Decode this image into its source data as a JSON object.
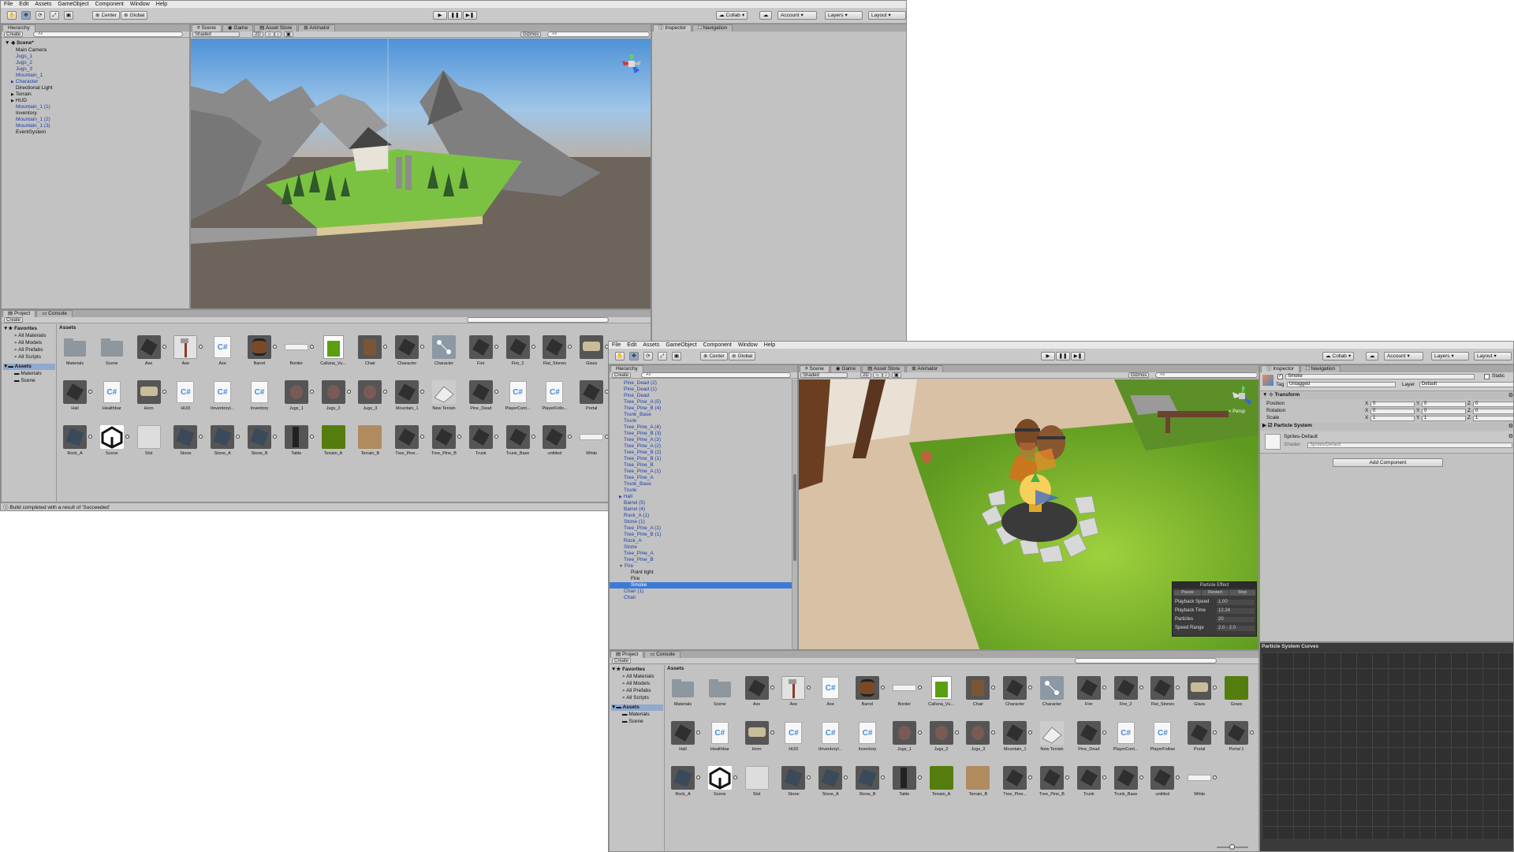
{
  "menu": [
    "File",
    "Edit",
    "Assets",
    "GameObject",
    "Component",
    "Window",
    "Help"
  ],
  "toolbar": {
    "center": "Center",
    "global": "Global",
    "collab": "Collab",
    "account": "Account",
    "layers": "Layers",
    "layout": "Layout"
  },
  "tabs": {
    "hierarchy": "Hierarchy",
    "scene": "Scene",
    "game": "Game",
    "asset_store": "Asset Store",
    "animator": "Animator",
    "inspector": "Inspector",
    "navigation": "Navigation",
    "project": "Project",
    "console": "Console"
  },
  "scene_bar": {
    "shaded": "Shaded",
    "two_d": "2D",
    "gizmos": "Gizmos",
    "all": "All"
  },
  "create": "Create",
  "w1": {
    "scene_name": "Scene*",
    "hierarchy": [
      {
        "label": "Main Camera",
        "depth": 1,
        "prefab": false,
        "arrow": ""
      },
      {
        "label": "Jugs_1",
        "depth": 1,
        "prefab": true,
        "arrow": ""
      },
      {
        "label": "Jugs_2",
        "depth": 1,
        "prefab": true,
        "arrow": ""
      },
      {
        "label": "Jugs_3",
        "depth": 1,
        "prefab": true,
        "arrow": ""
      },
      {
        "label": "Mountain_1",
        "depth": 1,
        "prefab": true,
        "arrow": ""
      },
      {
        "label": "Character",
        "depth": 1,
        "prefab": true,
        "arrow": "▶"
      },
      {
        "label": "Directional Light",
        "depth": 1,
        "prefab": false,
        "arrow": ""
      },
      {
        "label": "Terrain",
        "depth": 1,
        "prefab": false,
        "arrow": "▶"
      },
      {
        "label": "HUD",
        "depth": 1,
        "prefab": false,
        "arrow": "▶"
      },
      {
        "label": "Mountain_1 (1)",
        "depth": 1,
        "prefab": true,
        "arrow": ""
      },
      {
        "label": "Inventory",
        "depth": 1,
        "prefab": false,
        "arrow": ""
      },
      {
        "label": "Mountain_1 (2)",
        "depth": 1,
        "prefab": true,
        "arrow": ""
      },
      {
        "label": "Mountain_1 (3)",
        "depth": 1,
        "prefab": true,
        "arrow": ""
      },
      {
        "label": "EventSystem",
        "depth": 1,
        "prefab": false,
        "arrow": ""
      }
    ],
    "status": "Build completed with a result of 'Succeeded'"
  },
  "project": {
    "favorites": "Favorites",
    "fav_items": [
      "All Materials",
      "All Models",
      "All Prefabs",
      "All Scripts"
    ],
    "assets_folder": "Assets",
    "sub_folders": [
      "Materials",
      "Scene"
    ],
    "assets_header": "Assets"
  },
  "assets_w1": [
    {
      "label": "Materials",
      "icon": "folder"
    },
    {
      "label": "Scene",
      "icon": "folder"
    },
    {
      "label": "Axe",
      "icon": "dark"
    },
    {
      "label": "Axe",
      "icon": "axe"
    },
    {
      "label": "Axe",
      "icon": "script"
    },
    {
      "label": "Barrel",
      "icon": "barrel"
    },
    {
      "label": "Border",
      "icon": "bar"
    },
    {
      "label": "Calluna_Vu...",
      "icon": "green"
    },
    {
      "label": "Chair",
      "icon": "brown"
    },
    {
      "label": "Character",
      "icon": "dark"
    },
    {
      "label": "Character",
      "icon": "anim"
    },
    {
      "label": "Fire",
      "icon": "dark"
    },
    {
      "label": "Fire_2",
      "icon": "dark"
    },
    {
      "label": "Flat_Stones",
      "icon": "dark"
    },
    {
      "label": "Glass",
      "icon": "beige"
    },
    {
      "label": "Hall",
      "icon": "dark"
    },
    {
      "label": "Healthbar",
      "icon": "script"
    },
    {
      "label": "Horn",
      "icon": "beige"
    },
    {
      "label": "HUD",
      "icon": "script"
    },
    {
      "label": "IInventoryI...",
      "icon": "script"
    },
    {
      "label": "Inventory",
      "icon": "script"
    },
    {
      "label": "Jugs_1",
      "icon": "jug"
    },
    {
      "label": "Jugs_2",
      "icon": "jug"
    },
    {
      "label": "Jugs_3",
      "icon": "jug"
    },
    {
      "label": "Mountain_1",
      "icon": "dark"
    },
    {
      "label": "New Terrain",
      "icon": "terrain"
    },
    {
      "label": "Pine_Dead",
      "icon": "dark"
    },
    {
      "label": "PlayerCont...",
      "icon": "script"
    },
    {
      "label": "PlayerFollo...",
      "icon": "script"
    },
    {
      "label": "Portal",
      "icon": "dark"
    },
    {
      "label": "Rock_A",
      "icon": "rock"
    },
    {
      "label": "Scene",
      "icon": "unity"
    },
    {
      "label": "Slot",
      "icon": "white"
    },
    {
      "label": "Stone",
      "icon": "rock"
    },
    {
      "label": "Stone_A",
      "icon": "rock"
    },
    {
      "label": "Stone_B",
      "icon": "rock"
    },
    {
      "label": "Table",
      "icon": "table"
    },
    {
      "label": "Terrain_A",
      "icon": "moss"
    },
    {
      "label": "Terrain_B",
      "icon": "tan"
    },
    {
      "label": "Tree_Pine...",
      "icon": "dark"
    },
    {
      "label": "Tree_Pine_B",
      "icon": "dark"
    },
    {
      "label": "Trunk",
      "icon": "dark"
    },
    {
      "label": "Trunk_Base",
      "icon": "dark"
    },
    {
      "label": "untitled",
      "icon": "dark"
    },
    {
      "label": "White",
      "icon": "bar"
    }
  ],
  "w2": {
    "hierarchy": [
      {
        "label": "Pine_Dead (2)",
        "depth": 1,
        "prefab": true,
        "arrow": ""
      },
      {
        "label": "Pine_Dead (1)",
        "depth": 1,
        "prefab": true,
        "arrow": ""
      },
      {
        "label": "Pine_Dead",
        "depth": 1,
        "prefab": true,
        "arrow": ""
      },
      {
        "label": "Tree_Pine_A (5)",
        "depth": 1,
        "prefab": true,
        "arrow": ""
      },
      {
        "label": "Tree_Pine_B (4)",
        "depth": 1,
        "prefab": true,
        "arrow": ""
      },
      {
        "label": "Trunk_Base",
        "depth": 1,
        "prefab": true,
        "arrow": ""
      },
      {
        "label": "Trunk",
        "depth": 1,
        "prefab": true,
        "arrow": ""
      },
      {
        "label": "Tree_Pine_A (4)",
        "depth": 1,
        "prefab": true,
        "arrow": ""
      },
      {
        "label": "Tree_Pine_B (3)",
        "depth": 1,
        "prefab": true,
        "arrow": ""
      },
      {
        "label": "Tree_Pine_A (3)",
        "depth": 1,
        "prefab": true,
        "arrow": ""
      },
      {
        "label": "Tree_Pine_A (2)",
        "depth": 1,
        "prefab": true,
        "arrow": ""
      },
      {
        "label": "Tree_Pine_B (2)",
        "depth": 1,
        "prefab": true,
        "arrow": ""
      },
      {
        "label": "Tree_Pine_B (1)",
        "depth": 1,
        "prefab": true,
        "arrow": ""
      },
      {
        "label": "Tree_Pine_B",
        "depth": 1,
        "prefab": true,
        "arrow": ""
      },
      {
        "label": "Tree_Pine_A (1)",
        "depth": 1,
        "prefab": true,
        "arrow": ""
      },
      {
        "label": "Tree_Pine_A",
        "depth": 1,
        "prefab": true,
        "arrow": ""
      },
      {
        "label": "Trunk_Base",
        "depth": 1,
        "prefab": true,
        "arrow": ""
      },
      {
        "label": "Trunk",
        "depth": 1,
        "prefab": true,
        "arrow": ""
      },
      {
        "label": "Hall",
        "depth": 1,
        "prefab": true,
        "arrow": "▶"
      },
      {
        "label": "Barrel (5)",
        "depth": 1,
        "prefab": true,
        "arrow": ""
      },
      {
        "label": "Barrel (4)",
        "depth": 1,
        "prefab": true,
        "arrow": ""
      },
      {
        "label": "Rock_A (1)",
        "depth": 1,
        "prefab": true,
        "arrow": ""
      },
      {
        "label": "Stone (1)",
        "depth": 1,
        "prefab": true,
        "arrow": ""
      },
      {
        "label": "Tree_Pine_A (1)",
        "depth": 1,
        "prefab": true,
        "arrow": ""
      },
      {
        "label": "Tree_Pine_B (1)",
        "depth": 1,
        "prefab": true,
        "arrow": ""
      },
      {
        "label": "Rock_A",
        "depth": 1,
        "prefab": true,
        "arrow": ""
      },
      {
        "label": "Stone",
        "depth": 1,
        "prefab": true,
        "arrow": ""
      },
      {
        "label": "Tree_Pine_A",
        "depth": 1,
        "prefab": true,
        "arrow": ""
      },
      {
        "label": "Tree_Pine_B",
        "depth": 1,
        "prefab": true,
        "arrow": ""
      },
      {
        "label": "Fire",
        "depth": 1,
        "prefab": true,
        "arrow": "▼"
      },
      {
        "label": "Point light",
        "depth": 2,
        "prefab": false,
        "arrow": ""
      },
      {
        "label": "Fire",
        "depth": 2,
        "prefab": false,
        "arrow": ""
      },
      {
        "label": "Smoke",
        "depth": 2,
        "prefab": false,
        "arrow": "",
        "selected": true
      },
      {
        "label": "Chair (1)",
        "depth": 1,
        "prefab": true,
        "arrow": ""
      },
      {
        "label": "Chair",
        "depth": 1,
        "prefab": true,
        "arrow": ""
      }
    ],
    "persp": "< Persp",
    "particle_effect": {
      "title": "Particle Effect",
      "pause": "Pause",
      "restart": "Restart",
      "stop": "Stop",
      "rows": [
        {
          "label": "Playback Speed",
          "value": "1.00"
        },
        {
          "label": "Playback Time",
          "value": "12.24"
        },
        {
          "label": "Particles",
          "value": "20"
        },
        {
          "label": "Speed Range",
          "value": "2.0 - 2.0"
        }
      ]
    },
    "inspector": {
      "object_name": "Smoke",
      "static": "Static",
      "tag_label": "Tag",
      "tag_value": "Untagged",
      "layer_label": "Layer",
      "layer_value": "Default",
      "transform": "Transform",
      "rows": [
        {
          "label": "Position",
          "x": "0",
          "y": "0",
          "z": "0"
        },
        {
          "label": "Rotation",
          "x": "0",
          "y": "0",
          "z": "0"
        },
        {
          "label": "Scale",
          "x": "1",
          "y": "1",
          "z": "1"
        }
      ],
      "axis_x": "X",
      "axis_y": "Y",
      "axis_z": "Z",
      "particle_system": "Particle System",
      "material": "Sprites-Default",
      "shader_label": "Shader",
      "shader_value": "Sprites/Default",
      "add_component": "Add Component",
      "curves": "Particle System Curves"
    }
  },
  "assets_w2": [
    {
      "label": "Materials",
      "icon": "folder"
    },
    {
      "label": "Scene",
      "icon": "folder"
    },
    {
      "label": "Axe",
      "icon": "dark"
    },
    {
      "label": "Axe",
      "icon": "axe"
    },
    {
      "label": "Axe",
      "icon": "script"
    },
    {
      "label": "Barrel",
      "icon": "barrel"
    },
    {
      "label": "Border",
      "icon": "bar"
    },
    {
      "label": "Calluna_Vu...",
      "icon": "green"
    },
    {
      "label": "Chair",
      "icon": "brown"
    },
    {
      "label": "Character",
      "icon": "dark"
    },
    {
      "label": "Character",
      "icon": "anim"
    },
    {
      "label": "Fire",
      "icon": "dark"
    },
    {
      "label": "Fire_2",
      "icon": "dark"
    },
    {
      "label": "Flat_Stones",
      "icon": "dark"
    },
    {
      "label": "Glass",
      "icon": "beige"
    },
    {
      "label": "Grass",
      "icon": "moss"
    },
    {
      "label": "Hall",
      "icon": "dark"
    },
    {
      "label": "Healthbar",
      "icon": "script"
    },
    {
      "label": "Horn",
      "icon": "beige"
    },
    {
      "label": "HUD",
      "icon": "script"
    },
    {
      "label": "IInventoryI...",
      "icon": "script"
    },
    {
      "label": "Inventory",
      "icon": "script"
    },
    {
      "label": "Jugs_1",
      "icon": "jug"
    },
    {
      "label": "Jugs_2",
      "icon": "jug"
    },
    {
      "label": "Jugs_3",
      "icon": "jug"
    },
    {
      "label": "Mountain_1",
      "icon": "dark"
    },
    {
      "label": "New Terrain",
      "icon": "terrain"
    },
    {
      "label": "Pine_Dead",
      "icon": "dark"
    },
    {
      "label": "PlayerCont...",
      "icon": "script"
    },
    {
      "label": "PlayerFollow",
      "icon": "script"
    },
    {
      "label": "Portal",
      "icon": "dark"
    },
    {
      "label": "Portal 1",
      "icon": "dark"
    },
    {
      "label": "Rock_A",
      "icon": "rock"
    },
    {
      "label": "Scene",
      "icon": "unity"
    },
    {
      "label": "Slot",
      "icon": "white"
    },
    {
      "label": "Stone",
      "icon": "rock"
    },
    {
      "label": "Stone_A",
      "icon": "rock"
    },
    {
      "label": "Stone_B",
      "icon": "rock"
    },
    {
      "label": "Table",
      "icon": "table"
    },
    {
      "label": "Terrain_A",
      "icon": "moss"
    },
    {
      "label": "Terrain_B",
      "icon": "tan"
    },
    {
      "label": "Tree_Pine...",
      "icon": "dark"
    },
    {
      "label": "Tree_Pine_B",
      "icon": "dark"
    },
    {
      "label": "Trunk",
      "icon": "dark"
    },
    {
      "label": "Trunk_Base",
      "icon": "dark"
    },
    {
      "label": "untitled",
      "icon": "dark"
    },
    {
      "label": "White",
      "icon": "bar"
    }
  ],
  "colors": {
    "selection": "#3d7ad8",
    "prefab_text": "#1b3eab",
    "terrain_green": "#7cc242"
  }
}
